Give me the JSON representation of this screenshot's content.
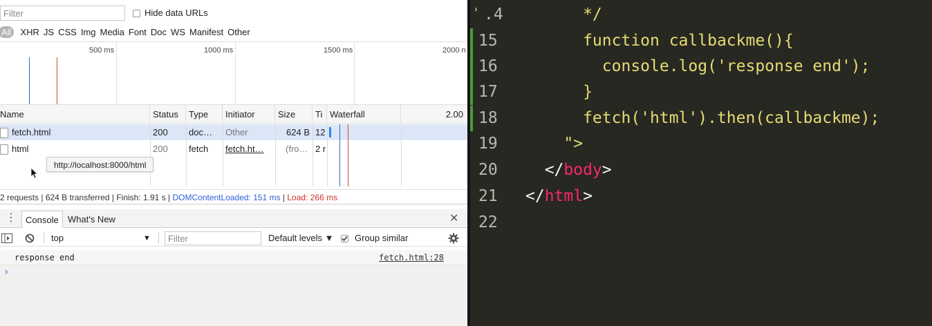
{
  "devtools": {
    "filter_placeholder": "Filter",
    "hide_data_urls_label": "Hide data URLs",
    "type_filters": [
      "All",
      "XHR",
      "JS",
      "CSS",
      "Img",
      "Media",
      "Font",
      "Doc",
      "WS",
      "Manifest",
      "Other"
    ],
    "timeline_labels": [
      "500 ms",
      "1000 ms",
      "1500 ms",
      "2000 n"
    ],
    "columns": [
      "Name",
      "Status",
      "Type",
      "Initiator",
      "Size",
      "Ti",
      "Waterfall",
      "2.00"
    ],
    "rows": [
      {
        "name": "fetch.html",
        "status": "200",
        "type": "doc…",
        "initiator": "Other",
        "size": "624 B",
        "time": "12"
      },
      {
        "name": "html",
        "status": "200",
        "type": "fetch",
        "initiator": "fetch.ht…",
        "size": "(fro…",
        "time": "2 r"
      }
    ],
    "tooltip": "http://localhost:8000/html",
    "summary": {
      "requests": "2 requests | 624 B transferred | Finish: 1.91 s | ",
      "dom_content_loaded": "DOMContentLoaded: 151 ms",
      "separator": " | ",
      "load": "Load: 266 ms"
    },
    "drawer": {
      "menu_glyph": "⋮",
      "tabs": [
        "Console",
        "What's New"
      ],
      "close_glyph": "✕"
    },
    "console_toolbar": {
      "context": "top",
      "filter_placeholder": "Filter",
      "levels": "Default levels ▼",
      "group_similar": "Group similar"
    },
    "console_output": {
      "message": "response end",
      "source": "fetch.html:28",
      "prompt": "›"
    },
    "colors": {
      "dcl": "#2b5fd9",
      "load": "#d0302a",
      "selected_row": "#dbe6f7"
    }
  },
  "editor": {
    "gutter_arrow": "›",
    "lines": [
      {
        "num": "14",
        "num_display": ".4",
        "code": "      */"
      },
      {
        "num": "15",
        "code": "      function callbackme(){",
        "git": true
      },
      {
        "num": "16",
        "code": "        console.log('response end');",
        "git": true
      },
      {
        "num": "17",
        "code": "      }",
        "git": true
      },
      {
        "num": "18",
        "code": "      fetch('html').then(callbackme);",
        "git": true
      },
      {
        "num": "19",
        "code": "    \">"
      },
      {
        "num": "20",
        "code_parts": [
          "  </",
          "body",
          ">"
        ]
      },
      {
        "num": "21",
        "code_parts": [
          "</",
          "html",
          ">"
        ]
      },
      {
        "num": "22",
        "code": ""
      }
    ],
    "colors": {
      "background": "#272822",
      "tag": "#f92672",
      "text": "#f8f8f2",
      "line_number": "#b9b9b2",
      "git_added": "#4a9d3a"
    }
  }
}
